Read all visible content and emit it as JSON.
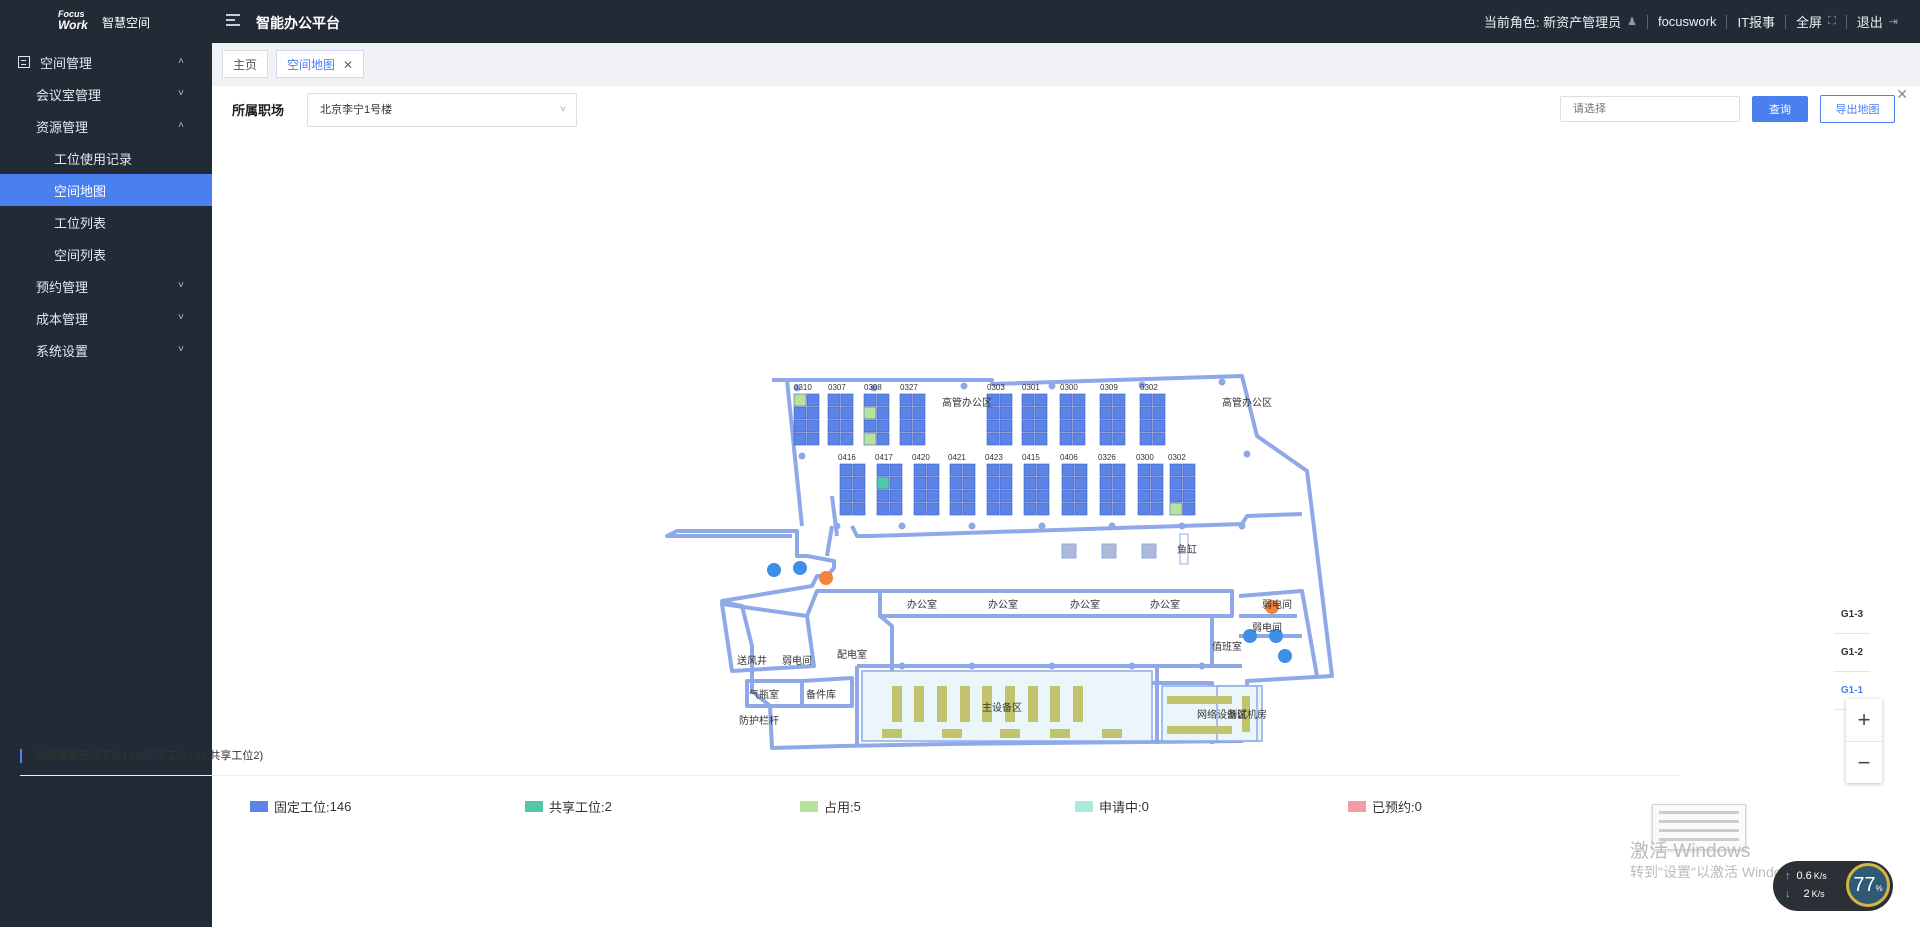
{
  "header": {
    "logo_mark_line1": "Focus",
    "logo_mark_line2": "Work",
    "logo_text": "智慧空间",
    "platform_title": "智能办公平台",
    "role_label": "当前角色: 新资产管理员",
    "user": "focuswork",
    "it_report": "IT报事",
    "fullscreen": "全屏",
    "logout": "退出"
  },
  "sidebar": {
    "items": [
      {
        "label": "空间管理",
        "level": 1,
        "icon": "grid-icon",
        "expanded": true
      },
      {
        "label": "会议室管理",
        "level": 2,
        "expanded": false
      },
      {
        "label": "资源管理",
        "level": 2,
        "expanded": true
      },
      {
        "label": "工位使用记录",
        "level": 3
      },
      {
        "label": "空间地图",
        "level": 3,
        "active": true
      },
      {
        "label": "工位列表",
        "level": 3
      },
      {
        "label": "空间列表",
        "level": 3
      },
      {
        "label": "预约管理",
        "level": 2,
        "expanded": false
      },
      {
        "label": "成本管理",
        "level": 2,
        "expanded": false
      },
      {
        "label": "系统设置",
        "level": 2,
        "expanded": false
      }
    ]
  },
  "tabs": [
    {
      "label": "主页",
      "active": false
    },
    {
      "label": "空间地图",
      "active": true,
      "closable": true
    }
  ],
  "filter": {
    "label": "所属职场",
    "selected": "北京李宁1号楼",
    "search_placeholder": "请选择",
    "query_button": "查询",
    "export_button": "导出地图"
  },
  "floorplan": {
    "rooms": [
      "高管办公区",
      "高管办公区",
      "鱼缸",
      "办公室",
      "办公室",
      "办公室",
      "办公室",
      "弱电间",
      "弱电间",
      "值班室",
      "送风井",
      "弱电间",
      "配电室",
      "气瓶室",
      "备件库",
      "防护栏杆",
      "主设备区",
      "网络设备区",
      "测试机房"
    ],
    "desk_codes_row1": [
      "0310",
      "0307",
      "0308",
      "0327",
      "0303",
      "0301",
      "0300",
      "0309",
      "0302"
    ],
    "desk_codes_row2": [
      "0416",
      "0417",
      "0420",
      "0421",
      "0423",
      "0415",
      "0406",
      "0326",
      "0300",
      "0302"
    ]
  },
  "floors": [
    "G1-3",
    "G1-2",
    "G1-1"
  ],
  "active_floor": "G1-1",
  "zoom": {
    "in": "+",
    "out": "−"
  },
  "summary": "当前楼层空闲工位143(固定工位141,共享工位2)",
  "legend": [
    {
      "label": "固定工位:",
      "value": "146",
      "color": "#5b83e8"
    },
    {
      "label": "共享工位:",
      "value": "2",
      "color": "#52c7a3"
    },
    {
      "label": "占用:",
      "value": "5",
      "color": "#b9e39d"
    },
    {
      "label": "申请中:",
      "value": "0",
      "color": "#a9eadb"
    },
    {
      "label": "已预约:",
      "value": "0",
      "color": "#f49ba4"
    }
  ],
  "watermark": {
    "line1": "激活 Windows",
    "line2": "转到\"设置\"以激活 Windows。"
  },
  "network": {
    "up": "0.6",
    "up_unit": "K/s",
    "down": "2",
    "down_unit": "K/s",
    "cpu": "77",
    "cpu_unit": "%"
  },
  "colors": {
    "accent": "#4a7ff0",
    "sidebar_bg": "#222b35",
    "wall": "#8fa8e8",
    "desk": "#5b83e8"
  }
}
